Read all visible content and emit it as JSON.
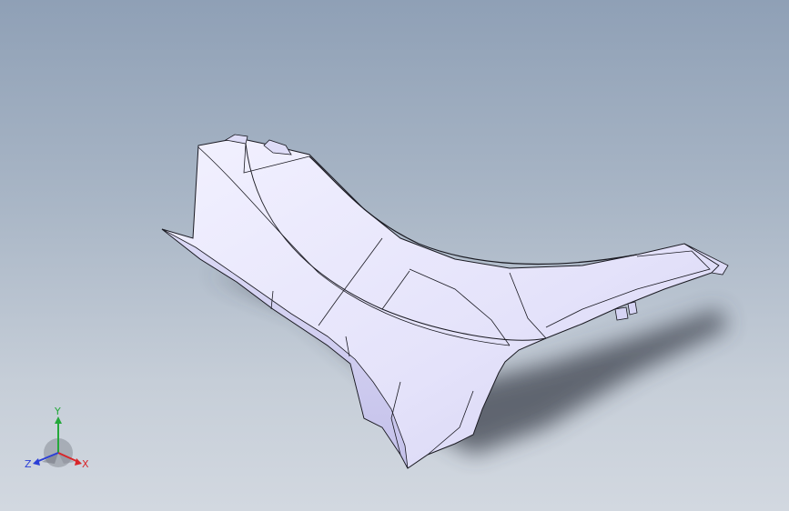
{
  "viewport": {
    "background_top": "#8fa0b6",
    "background_bottom": "#d2d8e0",
    "model": {
      "fill": "#e8e6fb",
      "shade": "#cfcdf0",
      "edge": "#1a1a22",
      "shadow": "#444a55"
    }
  },
  "triad": {
    "x_label": "X",
    "y_label": "Y",
    "z_label": "Z",
    "x_color": "#d8262a",
    "y_color": "#24a83a",
    "z_color": "#2b3fd6"
  }
}
